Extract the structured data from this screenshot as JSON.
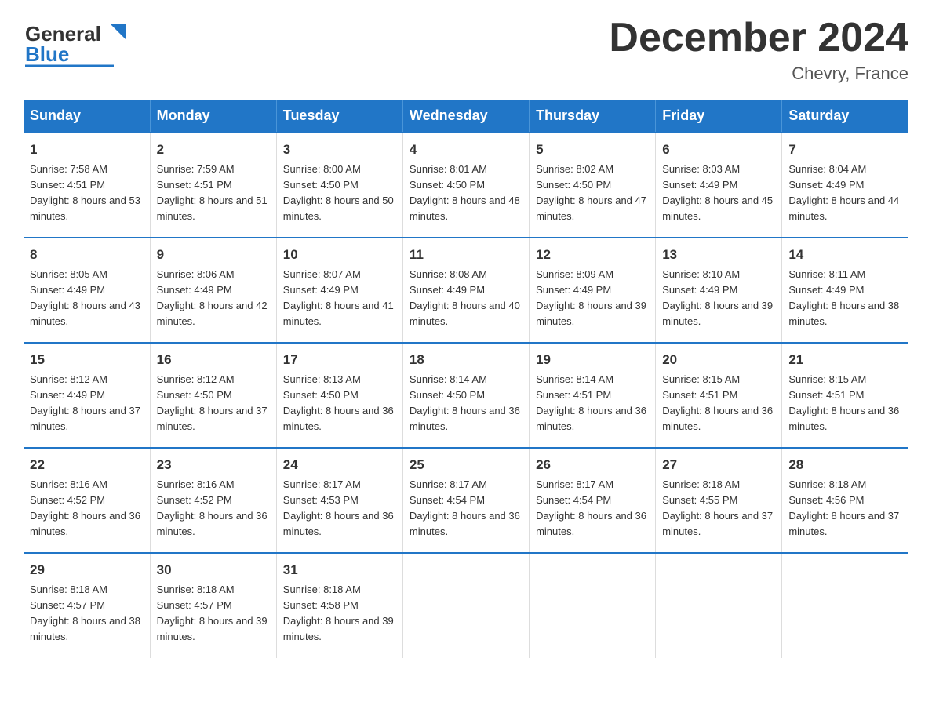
{
  "header": {
    "logo_general": "General",
    "logo_blue": "Blue",
    "month_title": "December 2024",
    "location": "Chevry, France"
  },
  "days_of_week": [
    "Sunday",
    "Monday",
    "Tuesday",
    "Wednesday",
    "Thursday",
    "Friday",
    "Saturday"
  ],
  "weeks": [
    [
      {
        "day": "1",
        "sunrise": "7:58 AM",
        "sunset": "4:51 PM",
        "daylight": "8 hours and 53 minutes."
      },
      {
        "day": "2",
        "sunrise": "7:59 AM",
        "sunset": "4:51 PM",
        "daylight": "8 hours and 51 minutes."
      },
      {
        "day": "3",
        "sunrise": "8:00 AM",
        "sunset": "4:50 PM",
        "daylight": "8 hours and 50 minutes."
      },
      {
        "day": "4",
        "sunrise": "8:01 AM",
        "sunset": "4:50 PM",
        "daylight": "8 hours and 48 minutes."
      },
      {
        "day": "5",
        "sunrise": "8:02 AM",
        "sunset": "4:50 PM",
        "daylight": "8 hours and 47 minutes."
      },
      {
        "day": "6",
        "sunrise": "8:03 AM",
        "sunset": "4:49 PM",
        "daylight": "8 hours and 45 minutes."
      },
      {
        "day": "7",
        "sunrise": "8:04 AM",
        "sunset": "4:49 PM",
        "daylight": "8 hours and 44 minutes."
      }
    ],
    [
      {
        "day": "8",
        "sunrise": "8:05 AM",
        "sunset": "4:49 PM",
        "daylight": "8 hours and 43 minutes."
      },
      {
        "day": "9",
        "sunrise": "8:06 AM",
        "sunset": "4:49 PM",
        "daylight": "8 hours and 42 minutes."
      },
      {
        "day": "10",
        "sunrise": "8:07 AM",
        "sunset": "4:49 PM",
        "daylight": "8 hours and 41 minutes."
      },
      {
        "day": "11",
        "sunrise": "8:08 AM",
        "sunset": "4:49 PM",
        "daylight": "8 hours and 40 minutes."
      },
      {
        "day": "12",
        "sunrise": "8:09 AM",
        "sunset": "4:49 PM",
        "daylight": "8 hours and 39 minutes."
      },
      {
        "day": "13",
        "sunrise": "8:10 AM",
        "sunset": "4:49 PM",
        "daylight": "8 hours and 39 minutes."
      },
      {
        "day": "14",
        "sunrise": "8:11 AM",
        "sunset": "4:49 PM",
        "daylight": "8 hours and 38 minutes."
      }
    ],
    [
      {
        "day": "15",
        "sunrise": "8:12 AM",
        "sunset": "4:49 PM",
        "daylight": "8 hours and 37 minutes."
      },
      {
        "day": "16",
        "sunrise": "8:12 AM",
        "sunset": "4:50 PM",
        "daylight": "8 hours and 37 minutes."
      },
      {
        "day": "17",
        "sunrise": "8:13 AM",
        "sunset": "4:50 PM",
        "daylight": "8 hours and 36 minutes."
      },
      {
        "day": "18",
        "sunrise": "8:14 AM",
        "sunset": "4:50 PM",
        "daylight": "8 hours and 36 minutes."
      },
      {
        "day": "19",
        "sunrise": "8:14 AM",
        "sunset": "4:51 PM",
        "daylight": "8 hours and 36 minutes."
      },
      {
        "day": "20",
        "sunrise": "8:15 AM",
        "sunset": "4:51 PM",
        "daylight": "8 hours and 36 minutes."
      },
      {
        "day": "21",
        "sunrise": "8:15 AM",
        "sunset": "4:51 PM",
        "daylight": "8 hours and 36 minutes."
      }
    ],
    [
      {
        "day": "22",
        "sunrise": "8:16 AM",
        "sunset": "4:52 PM",
        "daylight": "8 hours and 36 minutes."
      },
      {
        "day": "23",
        "sunrise": "8:16 AM",
        "sunset": "4:52 PM",
        "daylight": "8 hours and 36 minutes."
      },
      {
        "day": "24",
        "sunrise": "8:17 AM",
        "sunset": "4:53 PM",
        "daylight": "8 hours and 36 minutes."
      },
      {
        "day": "25",
        "sunrise": "8:17 AM",
        "sunset": "4:54 PM",
        "daylight": "8 hours and 36 minutes."
      },
      {
        "day": "26",
        "sunrise": "8:17 AM",
        "sunset": "4:54 PM",
        "daylight": "8 hours and 36 minutes."
      },
      {
        "day": "27",
        "sunrise": "8:18 AM",
        "sunset": "4:55 PM",
        "daylight": "8 hours and 37 minutes."
      },
      {
        "day": "28",
        "sunrise": "8:18 AM",
        "sunset": "4:56 PM",
        "daylight": "8 hours and 37 minutes."
      }
    ],
    [
      {
        "day": "29",
        "sunrise": "8:18 AM",
        "sunset": "4:57 PM",
        "daylight": "8 hours and 38 minutes."
      },
      {
        "day": "30",
        "sunrise": "8:18 AM",
        "sunset": "4:57 PM",
        "daylight": "8 hours and 39 minutes."
      },
      {
        "day": "31",
        "sunrise": "8:18 AM",
        "sunset": "4:58 PM",
        "daylight": "8 hours and 39 minutes."
      },
      {
        "day": "",
        "sunrise": "",
        "sunset": "",
        "daylight": ""
      },
      {
        "day": "",
        "sunrise": "",
        "sunset": "",
        "daylight": ""
      },
      {
        "day": "",
        "sunrise": "",
        "sunset": "",
        "daylight": ""
      },
      {
        "day": "",
        "sunrise": "",
        "sunset": "",
        "daylight": ""
      }
    ]
  ],
  "labels": {
    "sunrise": "Sunrise:",
    "sunset": "Sunset:",
    "daylight": "Daylight:"
  },
  "accent_color": "#2176c7"
}
